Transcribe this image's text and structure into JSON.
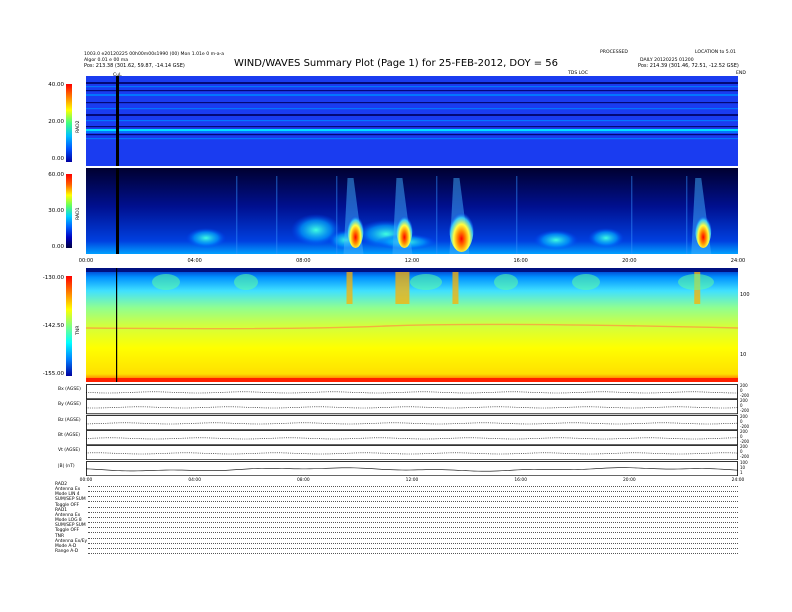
{
  "header": {
    "left_line1": "1003.0 e20120225 00h00m00s1990 (00) Mon 1.01e 0 m-a-a",
    "left_line2": "Algor 0.01 e 00 ma",
    "left_pos": "Pos: 213.38 (301.62, 59.87, -14.14 GSE)",
    "title": "WIND/WAVES Summary Plot (Page 1) for 25-FEB-2012, DOY = 56",
    "right_line1": "PROCESSED",
    "right_line2": "DAILY 20120225 01200",
    "right_line3": "LOCATION to 5.01",
    "right_pos": "Pos: 214.39 (301.46, 72.51, -12.52 GSE)",
    "small_c": "CuL",
    "tds_tag": "TDS LOC",
    "end_tag": "END"
  },
  "chart_data": [
    {
      "type": "heatmap",
      "name": "RAD2",
      "ylabel": "RAD2",
      "yticks": [
        "40.00",
        "20.00",
        "0.00"
      ],
      "colors": [
        "#0000a0",
        "#0050ff",
        "#00c0ff",
        "#40ff80",
        "#ffff00",
        "#ff8000",
        "#ff0000"
      ]
    },
    {
      "type": "heatmap",
      "name": "RAD1",
      "ylabel": "RAD1",
      "yticks": [
        "60.00",
        "30.00",
        "0.00"
      ],
      "xticks": [
        "00:00",
        "04:00",
        "08:00",
        "12:00",
        "16:00",
        "20:00",
        "24:00"
      ],
      "burst_hours": [
        9.7,
        11.5,
        13.6,
        22.5
      ],
      "colors": [
        "#000040",
        "#0000c0",
        "#0060ff",
        "#00d0ff",
        "#60ff60",
        "#ffff00",
        "#ff6000",
        "#ff0000"
      ]
    },
    {
      "type": "heatmap",
      "name": "TNR",
      "ylabel": "TNR",
      "yticks": [
        "-130.00",
        "-142.50",
        "-155.00"
      ],
      "right_ticks": [
        "100",
        "10"
      ],
      "colors": [
        "#0000a0",
        "#0080ff",
        "#00ffff",
        "#80ff80",
        "#ffff00",
        "#ff8000",
        "#ff0000"
      ]
    },
    {
      "type": "line",
      "name": "magnetic-field",
      "rows": [
        {
          "label": "Bx (AGSE)",
          "right": [
            "200",
            "0",
            "-200"
          ]
        },
        {
          "label": "By (AGSE)",
          "right": [
            "200",
            "0",
            "-200"
          ]
        },
        {
          "label": "Bz (AGSE)",
          "right": [
            "200",
            "0",
            "-200"
          ]
        },
        {
          "label": "Bt (AGSE)",
          "right": [
            "200",
            "0",
            "-200"
          ]
        },
        {
          "label": "Vt (AGSE)",
          "right": [
            "200",
            "0",
            "-200"
          ]
        },
        {
          "label": "|B| (nT)",
          "right": [
            "100",
            "10",
            "1"
          ]
        }
      ],
      "xticks": [
        "00:00",
        "04:00",
        "08:00",
        "12:00",
        "16:00",
        "20:00",
        "24:00"
      ]
    }
  ],
  "legend": {
    "lines": [
      "RAD2",
      "Antenna  Ex",
      "Mode   LIN 4",
      "SUM/SEP  SUM",
      "Toggle   OFF",
      "RAD1",
      "Antenna  Ex",
      "Mode   LOG 8",
      "SUM/SEP  SUM",
      "Toggle   OFF",
      "TNR",
      "Antenna  Ex/Ey",
      "Mode   A-D",
      "Range   A-D"
    ]
  }
}
